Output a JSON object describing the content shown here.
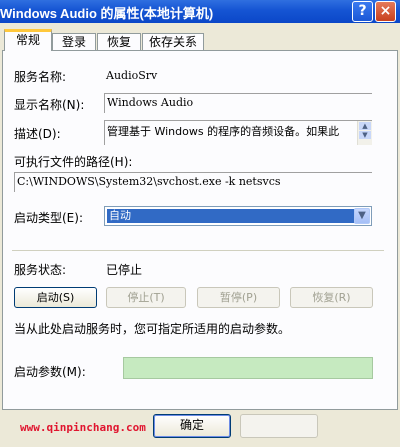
{
  "window": {
    "title": "Windows Audio 的属性(本地计算机)",
    "help": "?",
    "close": "×"
  },
  "tabs": [
    {
      "label": "常规"
    },
    {
      "label": "登录"
    },
    {
      "label": "恢复"
    },
    {
      "label": "依存关系"
    }
  ],
  "general": {
    "service_name_label": "服务名称:",
    "service_name": "AudioSrv",
    "display_name_label": "显示名称(N):",
    "display_name": "Windows Audio",
    "description_label": "描述(D):",
    "description": "管理基于 Windows 的程序的音频设备。如果此",
    "path_label": "可执行文件的路径(H):",
    "path": "C:\\WINDOWS\\System32\\svchost.exe -k netsvcs",
    "startup_type_label": "启动类型(E):",
    "startup_type": "自动",
    "status_label": "服务状态:",
    "status": "已停止",
    "start_label": "启动(S)",
    "stop_label": "停止(T)",
    "pause_label": "暂停(P)",
    "resume_label": "恢复(R)",
    "hint": "当从此处启动服务时，您可指定所适用的启动参数。",
    "params_label": "启动参数(M):",
    "params_value": ""
  },
  "footer": {
    "watermark": "www.qinpinchang.com",
    "ok_label": "确定"
  },
  "colors": {
    "titlebar": "#0b47c8",
    "selection": "#316ac5",
    "watermark": "#e0152f",
    "params_bg": "#c6eac0"
  }
}
